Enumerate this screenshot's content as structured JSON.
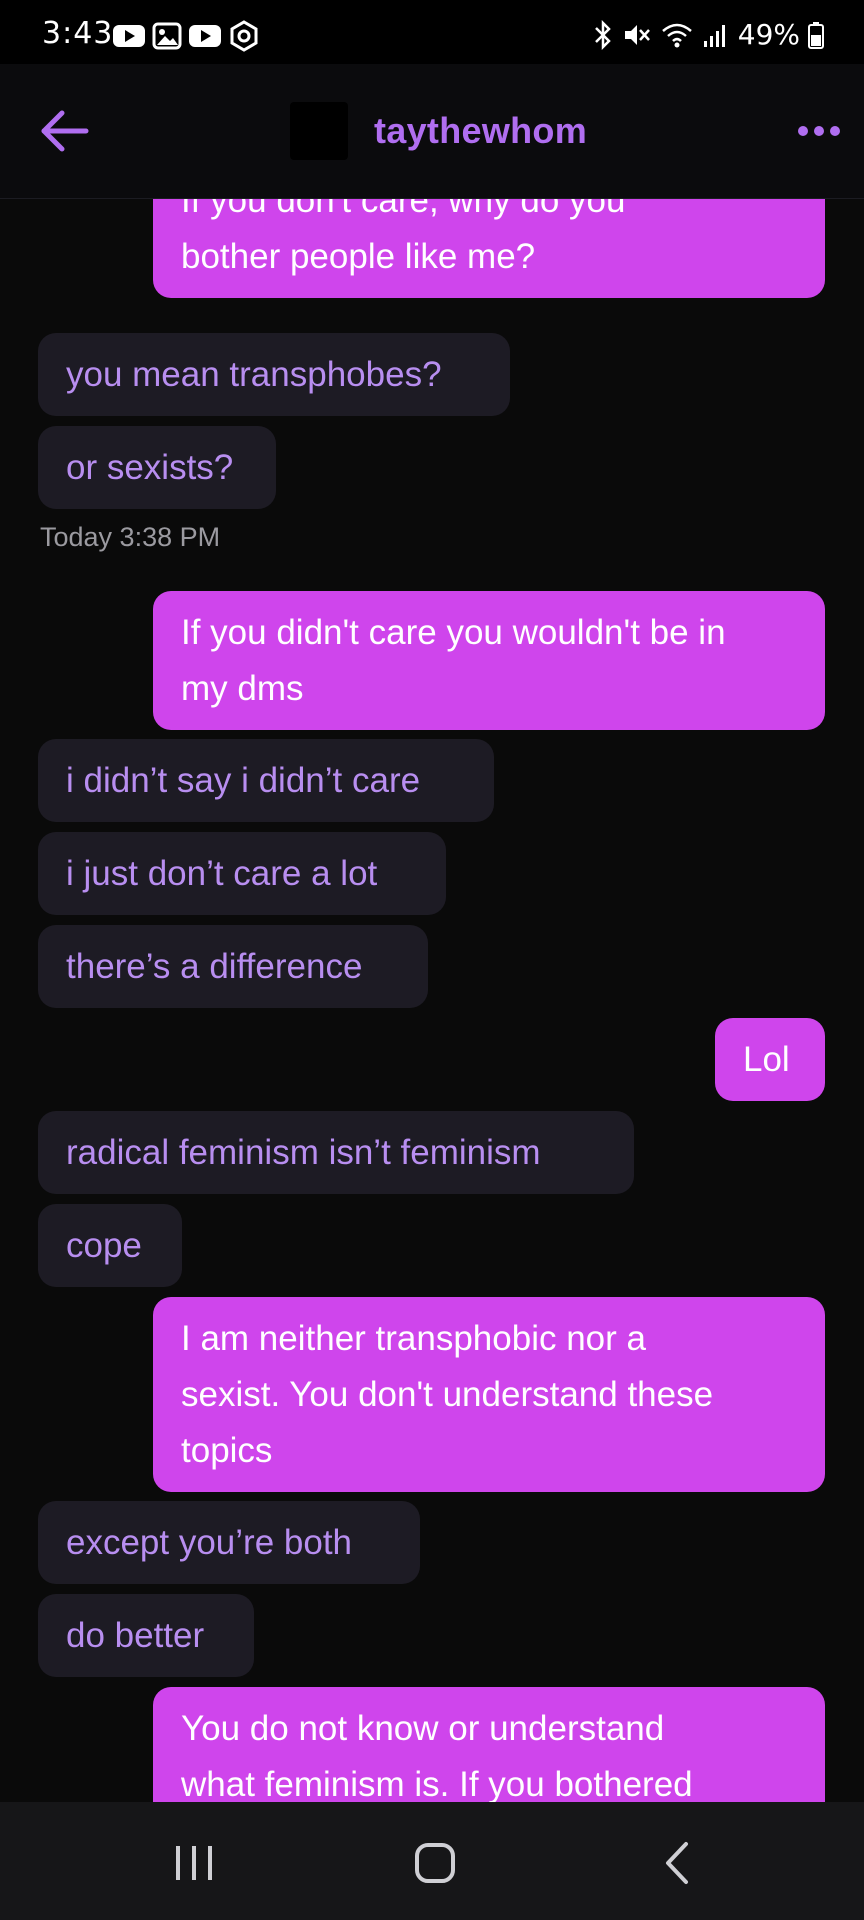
{
  "status_bar": {
    "time": "3:43",
    "battery": "49%"
  },
  "header": {
    "title": "taythewhom"
  },
  "messages": [
    {
      "dir": "out",
      "lines": [
        "If you don't care, why do you",
        "bother people like me?"
      ]
    },
    {
      "dir": "in",
      "lines": [
        "you mean transphobes?"
      ]
    },
    {
      "dir": "in",
      "lines": [
        "or sexists?"
      ]
    },
    {
      "timestamp": "Today 3:38 PM"
    },
    {
      "dir": "out",
      "lines": [
        "If you didn't care you wouldn't be in",
        "my dms"
      ]
    },
    {
      "dir": "in",
      "lines": [
        "i didn’t say i didn’t care"
      ]
    },
    {
      "dir": "in",
      "lines": [
        "i just don’t care a lot"
      ]
    },
    {
      "dir": "in",
      "lines": [
        "there’s a difference"
      ]
    },
    {
      "dir": "out",
      "lines": [
        "Lol"
      ]
    },
    {
      "dir": "in",
      "lines": [
        "radical feminism isn’t feminism"
      ]
    },
    {
      "dir": "in",
      "lines": [
        "cope"
      ]
    },
    {
      "dir": "out",
      "lines": [
        "I am neither transphobic nor a",
        "sexist. You don't understand these",
        "topics"
      ]
    },
    {
      "dir": "in",
      "lines": [
        "except you’re both"
      ]
    },
    {
      "dir": "in",
      "lines": [
        "do better"
      ]
    },
    {
      "dir": "out",
      "lines": [
        "You do not know or understand",
        "what feminism is. If you bothered"
      ]
    }
  ]
}
